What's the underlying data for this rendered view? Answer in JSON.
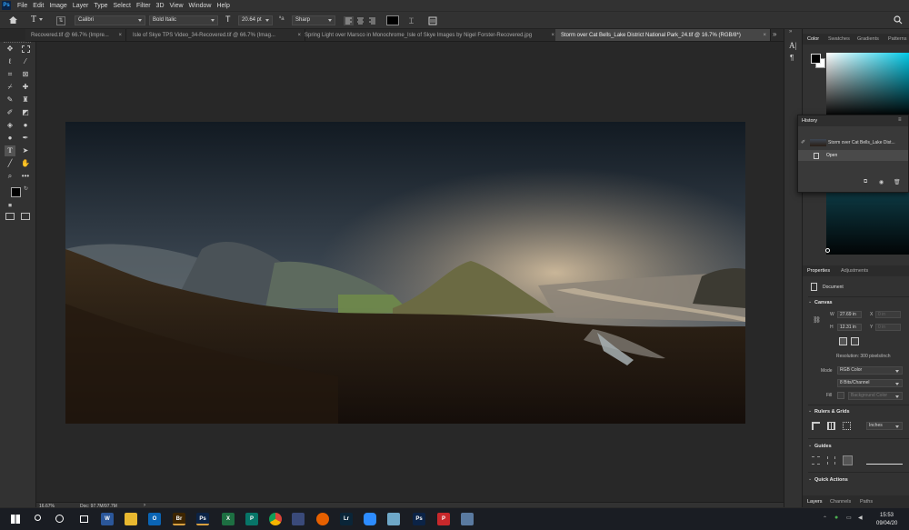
{
  "app": {
    "logo_text": "Ps",
    "accent": "#31a8ff"
  },
  "menu": [
    "File",
    "Edit",
    "Image",
    "Layer",
    "Type",
    "Select",
    "Filter",
    "3D",
    "View",
    "Window",
    "Help"
  ],
  "options": {
    "font_family": "Calibri",
    "font_style": "Bold Italic",
    "font_size": "20.64 pt",
    "antialias": "Sharp",
    "text_color": "#000000",
    "home_icon": "home-icon",
    "text_tool_icon": "text-tool-icon",
    "search_icon": "search-icon"
  },
  "tabs": [
    {
      "label": "Recovered.tif @ 66.7% (Impre...",
      "close": "×"
    },
    {
      "label": "Isle of Skye TPS Video_34-Recovered.tif @ 66.7% (Imag...",
      "close": "×"
    },
    {
      "label": "Spring Light over Marsco in Monochrome_Isle of Skye Images by Nigel Forster-Recovered.jpg",
      "close": "×"
    },
    {
      "label": "Storm over Cat Bells_Lake District National Park_24.tif @ 16.7% (RGB/8*)",
      "close": "×"
    }
  ],
  "tabs_overflow": "»",
  "status": {
    "zoom": "16.67%",
    "doc": "Doc: 97.7M/97.7M",
    "arrow": "›"
  },
  "panels": {
    "top_tabs": [
      "Color",
      "Swatches",
      "Gradients",
      "Patterns"
    ],
    "history": {
      "title": "History",
      "snapshot_label": "Storm over Cat Bells_Lake Dist...",
      "step_label": "Open",
      "menu_icon": "panel-menu-icon"
    },
    "properties_tabs": [
      "Properties",
      "Adjustments"
    ],
    "document_label": "Document",
    "canvas": {
      "title": "Canvas",
      "w_label": "W",
      "w_value": "27.69 in",
      "h_label": "H",
      "h_value": "12.31 in",
      "x_label": "X",
      "x_value": "0 in",
      "y_label": "Y",
      "y_value": "0 in",
      "resolution": "Resolution: 300 pixels/inch",
      "mode_label": "Mode",
      "mode_value": "RGB Color",
      "bits_value": "8 Bits/Channel",
      "fill_label": "Fill",
      "fill_value": "Background Color"
    },
    "rulers": {
      "title": "Rulers & Grids",
      "units": "Inches"
    },
    "guides": {
      "title": "Guides"
    },
    "quick_actions": {
      "title": "Quick Actions"
    },
    "bottom_tabs": [
      "Layers",
      "Channels",
      "Paths"
    ]
  },
  "taskbar": {
    "time": "15:53",
    "date": "09/04/20",
    "apps": [
      {
        "name": "windows-start-icon",
        "text": "",
        "color": "#1a1d23"
      },
      {
        "name": "search-icon",
        "text": "",
        "color": "#1a1d23"
      },
      {
        "name": "cortana-icon",
        "text": "",
        "color": "#1a1d23"
      },
      {
        "name": "task-view-icon",
        "text": "",
        "color": "#1a1d23"
      },
      {
        "name": "word-icon",
        "text": "W",
        "color": "#2b579a"
      },
      {
        "name": "file-explorer-icon",
        "text": "",
        "color": "#e8b830"
      },
      {
        "name": "outlook-icon",
        "text": "O",
        "color": "#0a64b4"
      },
      {
        "name": "bridge-icon",
        "text": "Br",
        "color": "#3d2500"
      },
      {
        "name": "photoshop-icon",
        "text": "Ps",
        "color": "#0b2346"
      },
      {
        "name": "excel-icon",
        "text": "X",
        "color": "#1d6f42"
      },
      {
        "name": "publisher-icon",
        "text": "P",
        "color": "#077568"
      },
      {
        "name": "chrome-icon",
        "text": "",
        "color": "#dd4b39"
      },
      {
        "name": "app-icon",
        "text": "",
        "color": "#3a4a7a"
      },
      {
        "name": "firefox-icon",
        "text": "",
        "color": "#e66000"
      },
      {
        "name": "lightroom-icon",
        "text": "Lr",
        "color": "#0a2538"
      },
      {
        "name": "zoom-icon",
        "text": "",
        "color": "#2d8cff"
      },
      {
        "name": "notes-icon",
        "text": "",
        "color": "#6fa8c8"
      },
      {
        "name": "photoshop-2-icon",
        "text": "Ps",
        "color": "#0b2346"
      },
      {
        "name": "pdf-icon",
        "text": "P",
        "color": "#c7282b"
      },
      {
        "name": "paint-icon",
        "text": "",
        "color": "#5a7aa0"
      }
    ]
  }
}
